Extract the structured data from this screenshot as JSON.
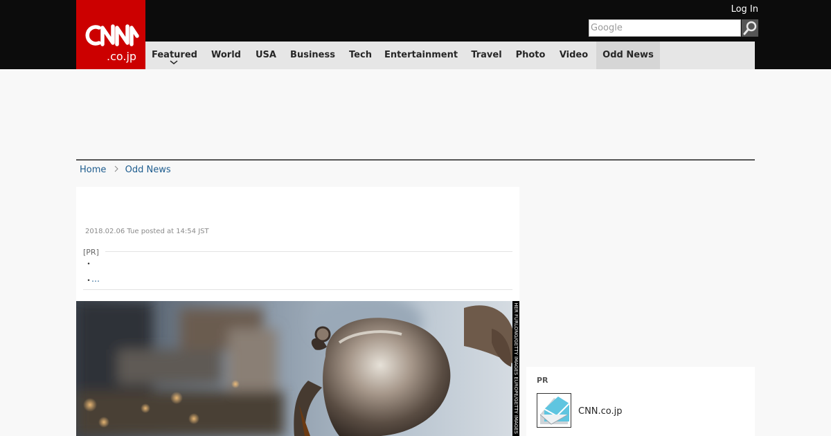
{
  "header": {
    "logo_text": "CNN .co.jp",
    "login_label": "Log In",
    "search_placeholder": "Google",
    "nav": [
      {
        "label": "Featured"
      },
      {
        "label": "World"
      },
      {
        "label": "USA"
      },
      {
        "label": "Business"
      },
      {
        "label": "Tech"
      },
      {
        "label": "Entertainment"
      },
      {
        "label": "Travel"
      },
      {
        "label": "Photo"
      },
      {
        "label": "Video"
      },
      {
        "label": "Odd News"
      }
    ],
    "active_nav": "Odd News"
  },
  "breadcrumb": {
    "home": "Home",
    "current": "Odd News"
  },
  "article": {
    "posted": "2018.02.06 Tue posted at 14:54 JST",
    "pr_label": "[PR]",
    "bullet": "・",
    "more": "…",
    "photo_credit": "HER FURLONG/GETTY IMAGES EUROPE/GETTY IMAGES"
  },
  "sidebar": {
    "pr_title": "PR",
    "pr_site": "CNN.co.jp"
  },
  "colors": {
    "brand_red": "#cc0000",
    "header_bg": "#0c0c0c",
    "link_blue": "#1d5c8e"
  }
}
